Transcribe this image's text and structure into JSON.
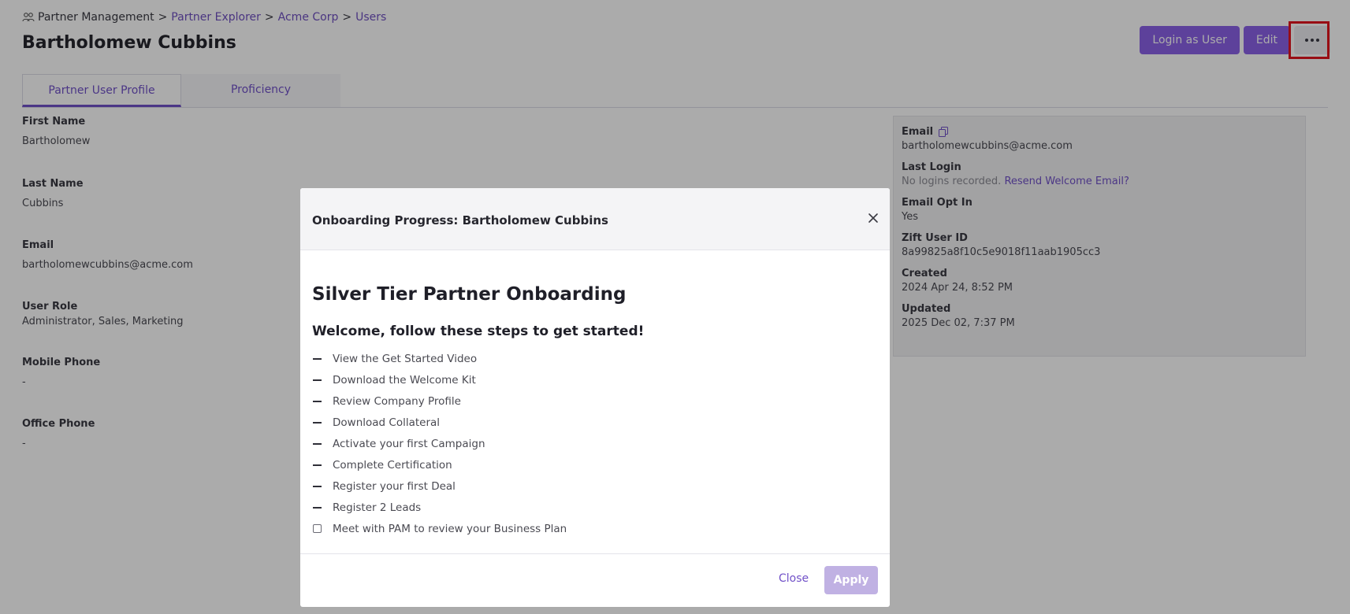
{
  "breadcrumb": {
    "root": "Partner Management",
    "separator": ">",
    "items": [
      "Partner Explorer",
      "Acme Corp",
      "Users"
    ]
  },
  "page": {
    "title": "Bartholomew Cubbins"
  },
  "header_actions": {
    "login_as_user": "Login as User",
    "edit": "Edit",
    "more_icon": "ellipsis-horizontal-icon"
  },
  "tabs": [
    {
      "label": "Partner User Profile",
      "active": true
    },
    {
      "label": "Proficiency",
      "active": false
    }
  ],
  "profile": {
    "first_name": {
      "label": "First Name",
      "value": "Bartholomew"
    },
    "last_name": {
      "label": "Last Name",
      "value": "Cubbins"
    },
    "email": {
      "label": "Email",
      "value": "bartholomewcubbins@acme.com"
    },
    "user_role": {
      "label": "User Role",
      "value": "Administrator, Sales, Marketing"
    },
    "mobile_phone": {
      "label": "Mobile Phone",
      "value": "-"
    },
    "office_phone": {
      "label": "Office Phone",
      "value": "-"
    }
  },
  "info_panel": {
    "email": {
      "label": "Email",
      "value": "bartholomewcubbins@acme.com",
      "icon": "copy-icon"
    },
    "last_login": {
      "label": "Last Login",
      "value": "No logins recorded.",
      "link": "Resend Welcome Email?"
    },
    "email_opt_in": {
      "label": "Email Opt In",
      "value": "Yes"
    },
    "zift_user_id": {
      "label": "Zift User ID",
      "value": "8a99825a8f10c5e9018f11aab1905cc3"
    },
    "created": {
      "label": "Created",
      "value": "2024 Apr 24, 8:52 PM"
    },
    "updated": {
      "label": "Updated",
      "value": "2025 Dec 02, 7:37 PM"
    }
  },
  "modal": {
    "title": "Onboarding Progress: Bartholomew Cubbins",
    "heading": "Silver Tier Partner Onboarding",
    "subheading": "Welcome, follow these steps to get started!",
    "steps": [
      {
        "label": "View the Get Started Video",
        "state": "indeterminate"
      },
      {
        "label": "Download the Welcome Kit",
        "state": "indeterminate"
      },
      {
        "label": "Review Company Profile",
        "state": "indeterminate"
      },
      {
        "label": "Download Collateral",
        "state": "indeterminate"
      },
      {
        "label": "Activate your first Campaign",
        "state": "indeterminate"
      },
      {
        "label": "Complete Certification",
        "state": "indeterminate"
      },
      {
        "label": "Register your first Deal",
        "state": "indeterminate"
      },
      {
        "label": "Register 2 Leads",
        "state": "indeterminate"
      },
      {
        "label": "Meet with PAM to review your Business Plan",
        "state": "unchecked"
      }
    ],
    "close_label": "Close",
    "apply_label": "Apply"
  },
  "colors": {
    "accent": "#8b61e8",
    "link": "#7151c8",
    "apply_disabled": "#c0b1e3",
    "highlight": "#e3141f"
  }
}
